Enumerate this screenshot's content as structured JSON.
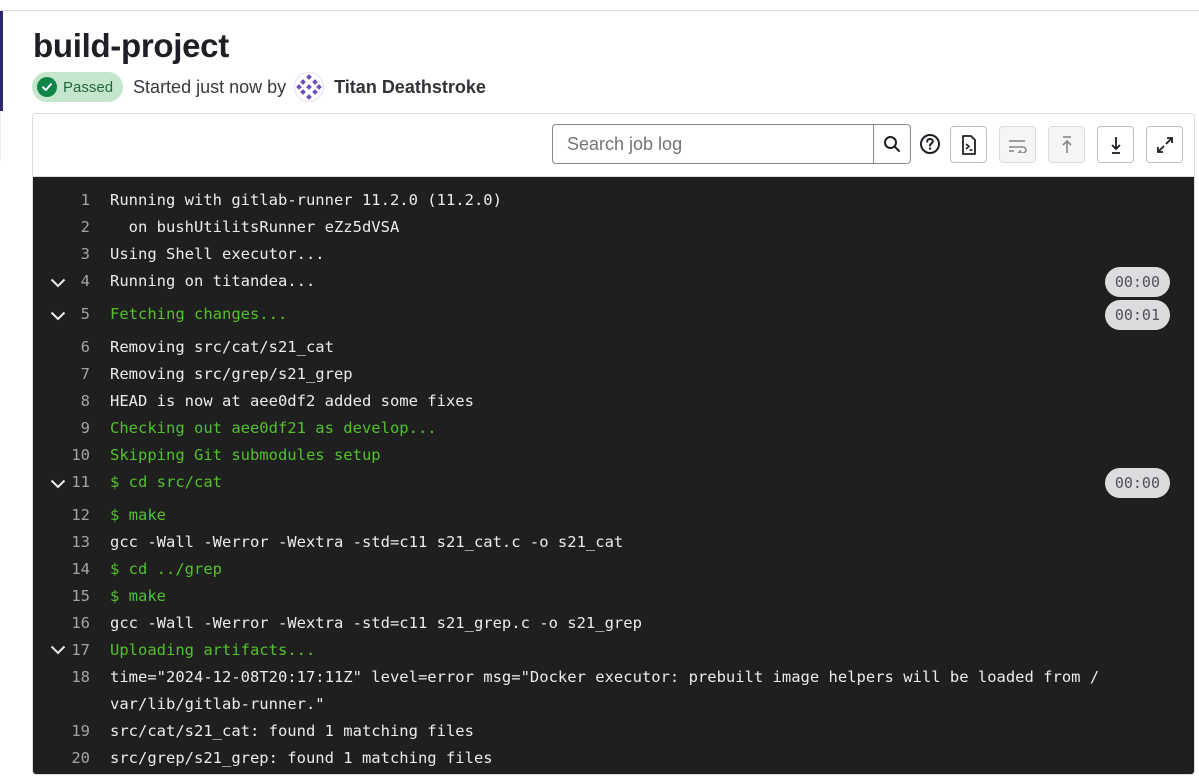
{
  "job": {
    "title": "build-project",
    "status": "Passed",
    "started_text": "Started just now by",
    "author": "Titan Deathstroke"
  },
  "toolbar": {
    "search_placeholder": "Search job log"
  },
  "icons": [
    "check-circle-icon",
    "search-icon",
    "help-icon",
    "raw-log-icon",
    "wrap-lines-icon",
    "scroll-to-top-icon",
    "scroll-to-bottom-icon",
    "fullscreen-icon",
    "chevron-down-icon"
  ],
  "log": {
    "lines": [
      {
        "n": "1",
        "text": "Running with gitlab-runner 11.2.0 (11.2.0)"
      },
      {
        "n": "2",
        "text": "  on bushUtilitsRunner eZz5dVSA"
      },
      {
        "n": "3",
        "text": "Using Shell executor..."
      },
      {
        "n": "4",
        "text": "Running on titandea...",
        "duration": "00:00"
      },
      {
        "n": "5",
        "text": "Fetching changes...",
        "duration": "00:01"
      },
      {
        "n": "6",
        "text": "Removing src/cat/s21_cat"
      },
      {
        "n": "7",
        "text": "Removing src/grep/s21_grep"
      },
      {
        "n": "8",
        "text": "HEAD is now at aee0df2 added some fixes"
      },
      {
        "n": "9",
        "text": "Checking out aee0df21 as develop..."
      },
      {
        "n": "10",
        "text": "Skipping Git submodules setup"
      },
      {
        "n": "11",
        "text": "$ cd src/cat",
        "duration": "00:00"
      },
      {
        "n": "12",
        "text": "$ make"
      },
      {
        "n": "13",
        "text": "gcc -Wall -Werror -Wextra -std=c11 s21_cat.c -o s21_cat"
      },
      {
        "n": "14",
        "text": "$ cd ../grep"
      },
      {
        "n": "15",
        "text": "$ make"
      },
      {
        "n": "16",
        "text": "gcc -Wall -Werror -Wextra -std=c11 s21_grep.c -o s21_grep"
      },
      {
        "n": "17",
        "text": "Uploading artifacts..."
      },
      {
        "n": "18",
        "text": "time=\"2024-12-08T20:17:11Z\" level=error msg=\"Docker executor: prebuilt image helpers will be loaded from /\nvar/lib/gitlab-runner.\""
      },
      {
        "n": "19",
        "text": "src/cat/s21_cat: found 1 matching files"
      },
      {
        "n": "20",
        "text": "src/grep/s21_grep: found 1 matching files"
      }
    ]
  },
  "colors": {
    "success_bg": "#c3e6cd",
    "success_icon": "#108548",
    "log_bg": "#1f1f1f",
    "log_green": "#52c12c"
  }
}
